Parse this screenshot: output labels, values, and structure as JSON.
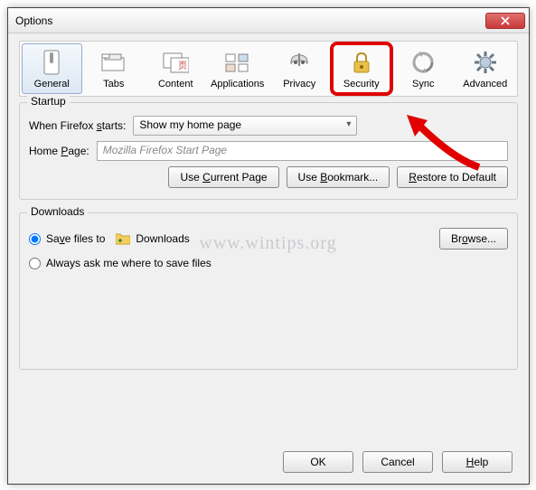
{
  "window": {
    "title": "Options"
  },
  "toolbar": {
    "items": [
      {
        "label": "General"
      },
      {
        "label": "Tabs"
      },
      {
        "label": "Content"
      },
      {
        "label": "Applications"
      },
      {
        "label": "Privacy"
      },
      {
        "label": "Security"
      },
      {
        "label": "Sync"
      },
      {
        "label": "Advanced"
      }
    ]
  },
  "startup": {
    "title": "Startup",
    "when_label": "When Firefox starts:",
    "when_value": "Show my home page",
    "homepage_label": "Home Page:",
    "homepage_value": "Mozilla Firefox Start Page",
    "use_current": "Use Current Page",
    "use_bookmark": "Use Bookmark...",
    "restore_default": "Restore to Default"
  },
  "downloads": {
    "title": "Downloads",
    "save_to_label": "Save files to",
    "save_to_value": "Downloads",
    "always_ask_label": "Always ask me where to save files",
    "browse": "Browse...",
    "selected": "save_to"
  },
  "footer": {
    "ok": "OK",
    "cancel": "Cancel",
    "help": "Help"
  },
  "watermark": "www.wintips.org"
}
